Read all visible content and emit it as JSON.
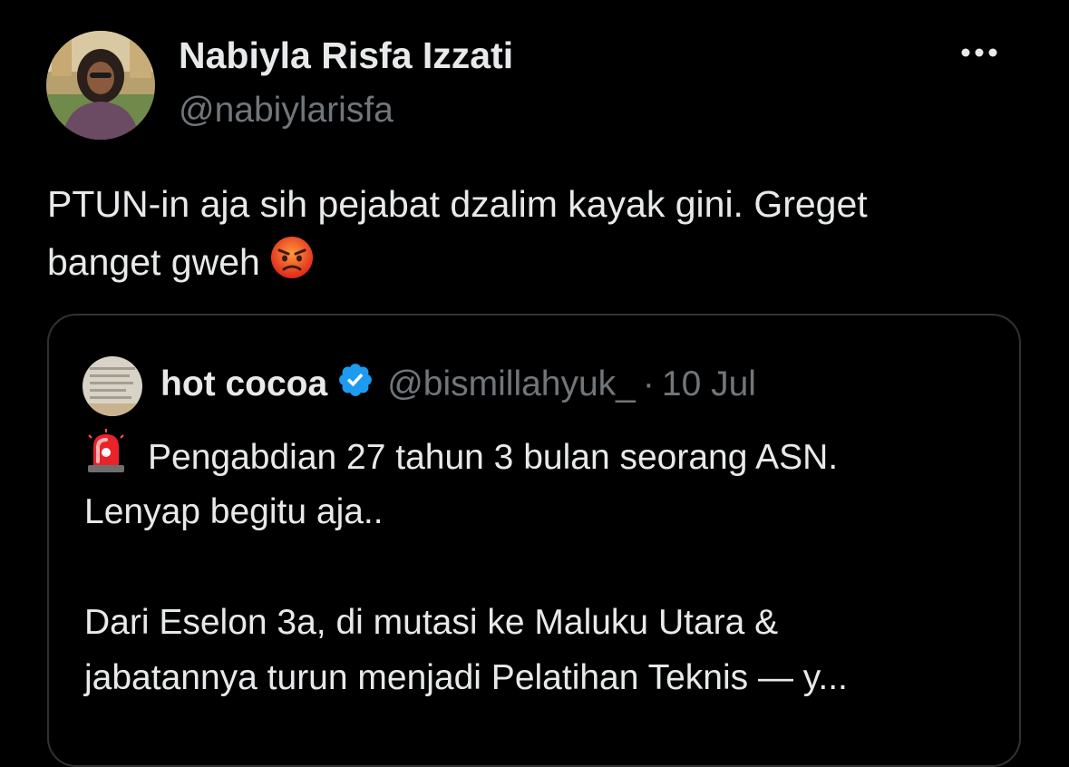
{
  "tweet": {
    "author": {
      "display_name": "Nabiyla Risfa Izzati",
      "handle": "@nabiylarisfa",
      "avatar_icon": "profile-photo-avatar"
    },
    "more_icon": "more-options-icon",
    "text_lines": [
      "PTUN-in aja sih pejabat dzalim kayak gini. Greget",
      "banget gweh"
    ],
    "emoji": "angry-face-emoji"
  },
  "quote": {
    "author": {
      "display_name": "hot cocoa",
      "handle": "@bismillahyuk_",
      "separator": "·",
      "time": "10 Jul",
      "verified": true,
      "verified_icon": "verified-badge-icon",
      "avatar_icon": "profile-photo-avatar"
    },
    "lead_emoji": "police-car-light-emoji",
    "text_lines": [
      "Pengabdian 27 tahun 3 bulan seorang ASN.",
      "Lenyap begitu aja..",
      "",
      "Dari Eselon 3a, di mutasi ke Maluku Utara &",
      "jabatannya turun menjadi Pelatihan Teknis — y..."
    ]
  },
  "colors": {
    "background": "#000000",
    "text_primary": "#e7e9ea",
    "text_secondary": "#71767b",
    "card_border": "#2f3336",
    "verified_blue": "#1d9bf0"
  }
}
